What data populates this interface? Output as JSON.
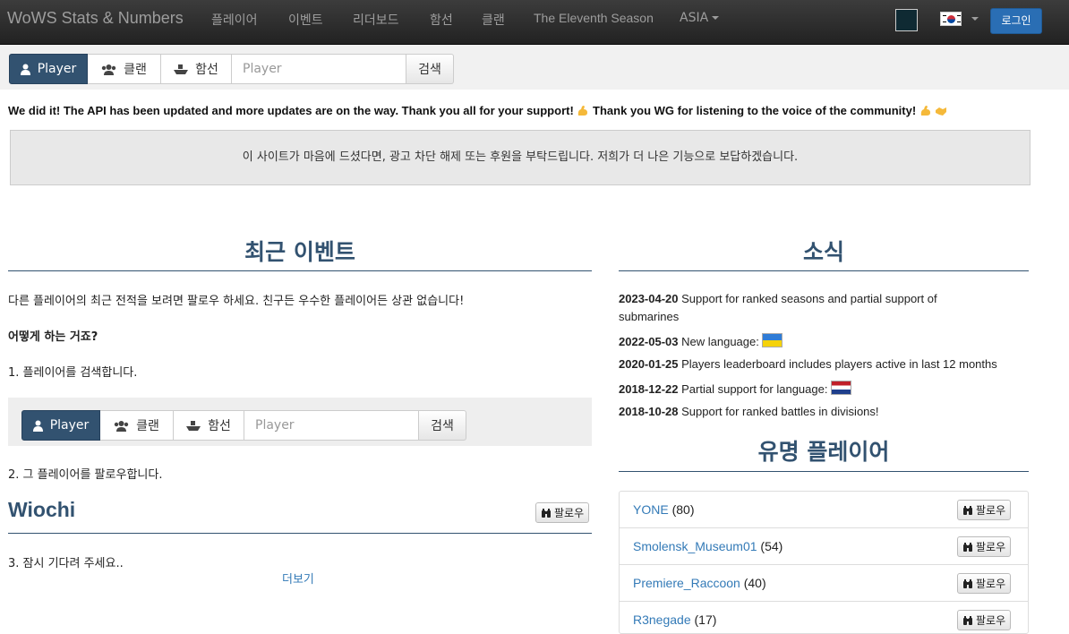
{
  "nav": {
    "brand": "WoWS Stats & Numbers",
    "items": [
      "플레이어",
      "이벤트",
      "리더보드",
      "함선",
      "클랜",
      "The Eleventh Season"
    ],
    "region": "ASIA",
    "login": "로그인"
  },
  "search": {
    "tabs": [
      "Player",
      "클랜",
      "함선"
    ],
    "placeholder": "Player",
    "button": "검색"
  },
  "announcement": {
    "part1": "We did it! The API has been updated and more updates are on the way. Thank you all for your support!",
    "part2": "Thank you WG for listening to the voice of the community!"
  },
  "donate_text": "이 사이트가 마음에 드셨다면, 광고 차단 해제 또는 후원을 부탁드립니다. 저희가 더 나은 기능으로 보답하겠습니다.",
  "events": {
    "heading": "최근 이벤트",
    "intro": "다른 플레이어의 최근 전적을 보려면 팔로우 하세요. 친구든 우수한 플레이어든 상관 없습니다!",
    "how": "어떻게 하는 거죠?",
    "step1": "1. 플레이어를 검색합니다.",
    "step2": "2. 그 플레이어를 팔로우합니다.",
    "example_player": "Wiochi",
    "follow": "팔로우",
    "step3": "3. 잠시 기다려 주세요..",
    "more": "더보기"
  },
  "news": {
    "heading": "소식",
    "items": [
      {
        "date": "2023-04-20",
        "text": "Support for ranked seasons and partial support of"
      },
      {
        "date": "",
        "text": "submarines"
      },
      {
        "date": "2022-05-03",
        "text": "New language:"
      },
      {
        "date": "2020-01-25",
        "text": "Players leaderboard includes players active in last 12 months"
      },
      {
        "date": "2018-12-22",
        "text": "Partial support for language:"
      },
      {
        "date": "2018-10-28",
        "text": "Support for ranked battles in divisions!"
      }
    ]
  },
  "famous": {
    "heading": "유명 플레이어",
    "players": [
      {
        "name": "YONE",
        "count": "(80)"
      },
      {
        "name": "Smolensk_Museum01",
        "count": "(54)"
      },
      {
        "name": "Premiere_Raccoon",
        "count": "(40)"
      },
      {
        "name": "R3negade",
        "count": "(17)"
      }
    ],
    "follow": "팔로우"
  }
}
